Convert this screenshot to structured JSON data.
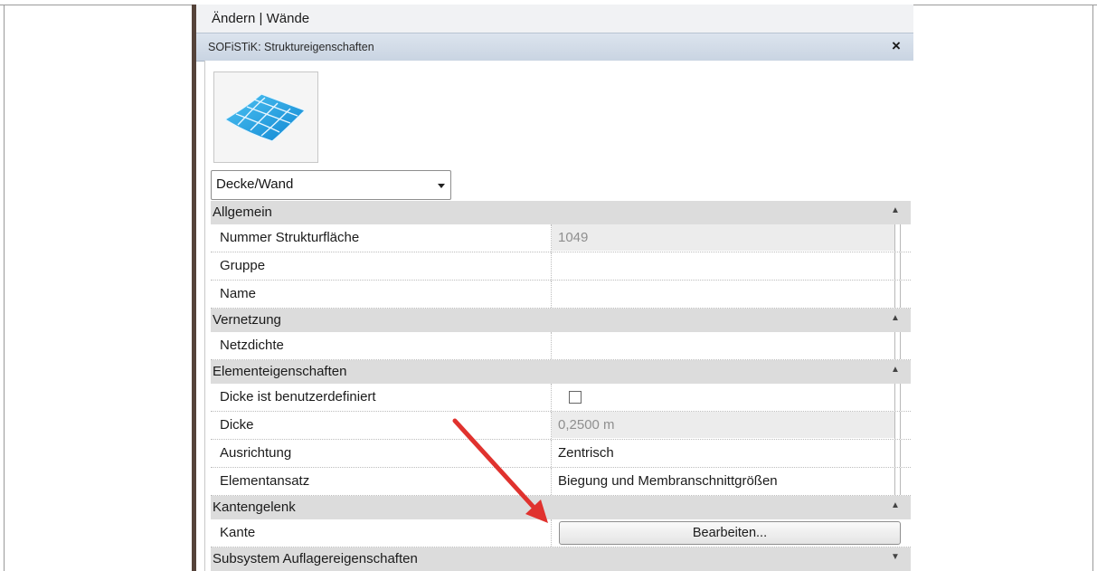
{
  "ribbon_context": "Ändern | Wände",
  "panel": {
    "title": "SOFiSTiK: Struktureigenschaften",
    "close_label": "×",
    "preview_icon": "surface-mesh-icon",
    "type_selector": {
      "value": "Decke/Wand"
    }
  },
  "sections": {
    "allgemein": {
      "label": "Allgemein",
      "toggle": "▲",
      "rows": [
        {
          "key": "Nummer Strukturfläche",
          "value": "1049"
        },
        {
          "key": "Gruppe",
          "value": ""
        },
        {
          "key": "Name",
          "value": ""
        }
      ]
    },
    "vernetzung": {
      "label": "Vernetzung",
      "toggle": "▲",
      "rows": [
        {
          "key": "Netzdichte",
          "value": ""
        }
      ]
    },
    "elementeigenschaften": {
      "label": "Elementeigenschaften",
      "toggle": "▲",
      "rows": [
        {
          "key": "Dicke ist benutzerdefiniert",
          "checked": false
        },
        {
          "key": "Dicke",
          "value": "0,2500 m"
        },
        {
          "key": "Ausrichtung",
          "value": "Zentrisch"
        },
        {
          "key": "Elementansatz",
          "value": "Biegung und Membranschnittgrößen"
        }
      ]
    },
    "kantengelenk": {
      "label": "Kantengelenk",
      "toggle": "▲",
      "rows": [
        {
          "key": "Kante",
          "button": "Bearbeiten..."
        }
      ]
    },
    "subsystem": {
      "label": "Subsystem Auflagereigenschaften",
      "toggle": "▼"
    }
  },
  "colors": {
    "annotation_arrow": "#e0322e",
    "titlebar": "#d2dbe8",
    "section_bg": "#dcdcdc"
  }
}
